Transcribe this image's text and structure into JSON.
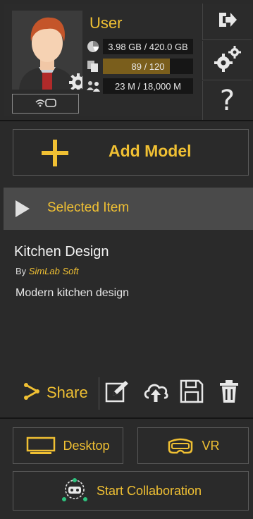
{
  "user": {
    "name": "User",
    "storage": "3.98 GB / 420.0 GB",
    "models": "89 / 120",
    "models_fraction": 0.742,
    "traffic": "23 M / 18,000 M"
  },
  "add_model_label": "Add Model",
  "selected": {
    "header": "Selected Item",
    "title": "Kitchen Design",
    "by_prefix": "By",
    "author": "SimLab Soft",
    "description": "Modern kitchen design"
  },
  "actions": {
    "share_label": "Share"
  },
  "bottom": {
    "desktop_label": "Desktop",
    "vr_label": "VR",
    "collab_label": "Start Collaboration"
  },
  "colors": {
    "accent": "#f0c033",
    "background": "#2a2a2a",
    "header": "#4a4a4a"
  }
}
